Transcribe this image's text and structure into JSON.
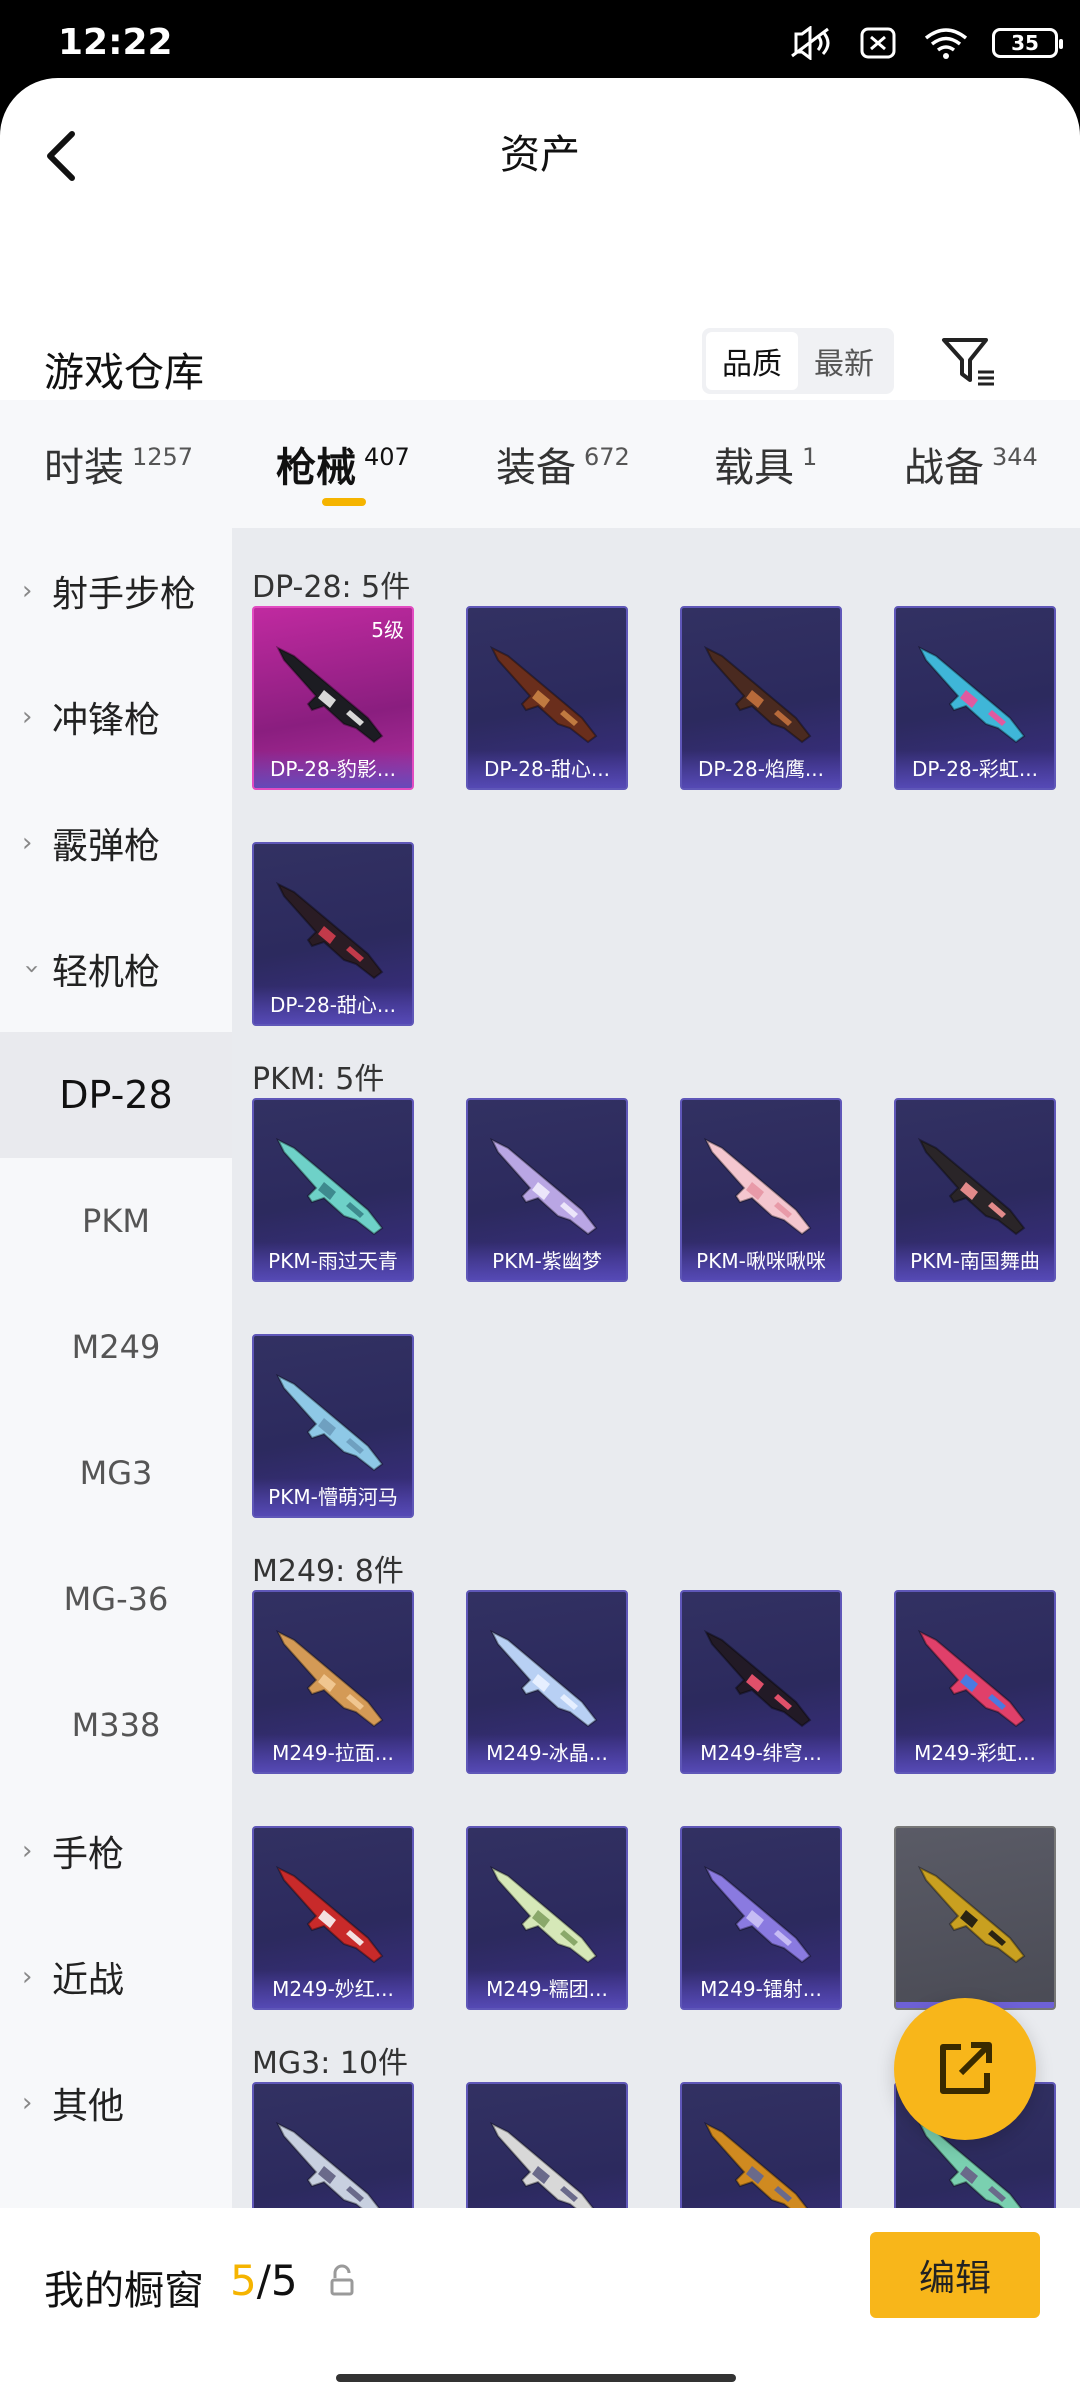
{
  "status": {
    "time": "12:22",
    "battery": "35"
  },
  "header": {
    "title": "资产"
  },
  "section": {
    "title": "游戏仓库",
    "sort_options": [
      "品质",
      "最新"
    ],
    "sort_active": "品质"
  },
  "tabs": [
    {
      "label": "时装",
      "count": "1257"
    },
    {
      "label": "枪械",
      "count": "407"
    },
    {
      "label": "装备",
      "count": "672"
    },
    {
      "label": "载具",
      "count": "1"
    },
    {
      "label": "战备",
      "count": "344"
    }
  ],
  "sidebar": {
    "categories_top": [
      {
        "label": "射手步枪"
      },
      {
        "label": "冲锋枪"
      },
      {
        "label": "霰弹枪"
      },
      {
        "label": "轻机枪"
      }
    ],
    "sub_items": [
      "DP-28",
      "PKM",
      "M249",
      "MG3",
      "MG-36",
      "M338"
    ],
    "categories_bottom": [
      {
        "label": "手枪"
      },
      {
        "label": "近战"
      },
      {
        "label": "其他"
      }
    ]
  },
  "groups": [
    {
      "title": "DP-28: 5件",
      "items": [
        {
          "name": "DP-28-豹影...",
          "badge": "5级",
          "style": "orange",
          "gun": "#1c1c22",
          "accent": "#d8d8d8"
        },
        {
          "name": "DP-28-甜心...",
          "style": "purple",
          "gun": "#6a2e1c",
          "accent": "#c07a40"
        },
        {
          "name": "DP-28-焰鹰...",
          "style": "purple",
          "gun": "#4a2a20",
          "accent": "#b86a3a"
        },
        {
          "name": "DP-28-彩虹...",
          "style": "purple",
          "gun": "#3fb6d8",
          "accent": "#e05aa0"
        },
        {
          "name": "DP-28-甜心...",
          "style": "purple",
          "gun": "#2a1c24",
          "accent": "#c23a4a"
        }
      ]
    },
    {
      "title": "PKM: 5件",
      "items": [
        {
          "name": "PKM-雨过天青",
          "style": "purple",
          "gun": "#6ed1c8",
          "accent": "#3e8a8e"
        },
        {
          "name": "PKM-紫幽梦",
          "style": "purple",
          "gun": "#b9a6e4",
          "accent": "#ece6fa"
        },
        {
          "name": "PKM-啾咪啾咪",
          "style": "purple",
          "gun": "#f4c6cf",
          "accent": "#e89aa8"
        },
        {
          "name": "PKM-南国舞曲",
          "style": "purple",
          "gun": "#2a2528",
          "accent": "#e28a8a"
        },
        {
          "name": "PKM-懵萌河马",
          "style": "purple",
          "gun": "#8ec8e6",
          "accent": "#6fa0c0"
        }
      ]
    },
    {
      "title": "M249: 8件",
      "items": [
        {
          "name": "M249-拉面...",
          "style": "purple",
          "gun": "#d49a56",
          "accent": "#f0c690"
        },
        {
          "name": "M249-冰晶...",
          "style": "purple",
          "gun": "#b8d0f4",
          "accent": "#e6efff"
        },
        {
          "name": "M249-绯穹...",
          "style": "purple",
          "gun": "#221a26",
          "accent": "#e0506a"
        },
        {
          "name": "M249-彩虹...",
          "style": "purple",
          "gun": "#e0406a",
          "accent": "#4a7ae0"
        },
        {
          "name": "M249-妙红...",
          "style": "purple",
          "gun": "#c82a2a",
          "accent": "#f4e0e0"
        },
        {
          "name": "M249-糯团...",
          "style": "purple",
          "gun": "#d6e8b8",
          "accent": "#8aa86a"
        },
        {
          "name": "M249-镭射...",
          "style": "purple",
          "gun": "#8a7ae0",
          "accent": "#c6bcf4"
        },
        {
          "name": "",
          "style": "gold",
          "gun": "#c9a020",
          "accent": "#2a2412"
        }
      ]
    },
    {
      "title": "MG3: 10件",
      "items": [
        {
          "name": "",
          "style": "purple",
          "gun": "#c8d0e0",
          "accent": "#6a6a8a"
        },
        {
          "name": "",
          "style": "purple",
          "gun": "#d8d8d8",
          "accent": "#6a6a8a"
        },
        {
          "name": "",
          "style": "purple",
          "gun": "#d08a20",
          "accent": "#6a6a8a"
        },
        {
          "name": "",
          "style": "purple",
          "gun": "#7ad0b0",
          "accent": "#6a6a8a"
        }
      ]
    }
  ],
  "bottom": {
    "label": "我的橱窗",
    "count_current": "5",
    "count_sep_total": "/5",
    "edit_label": "编辑"
  }
}
